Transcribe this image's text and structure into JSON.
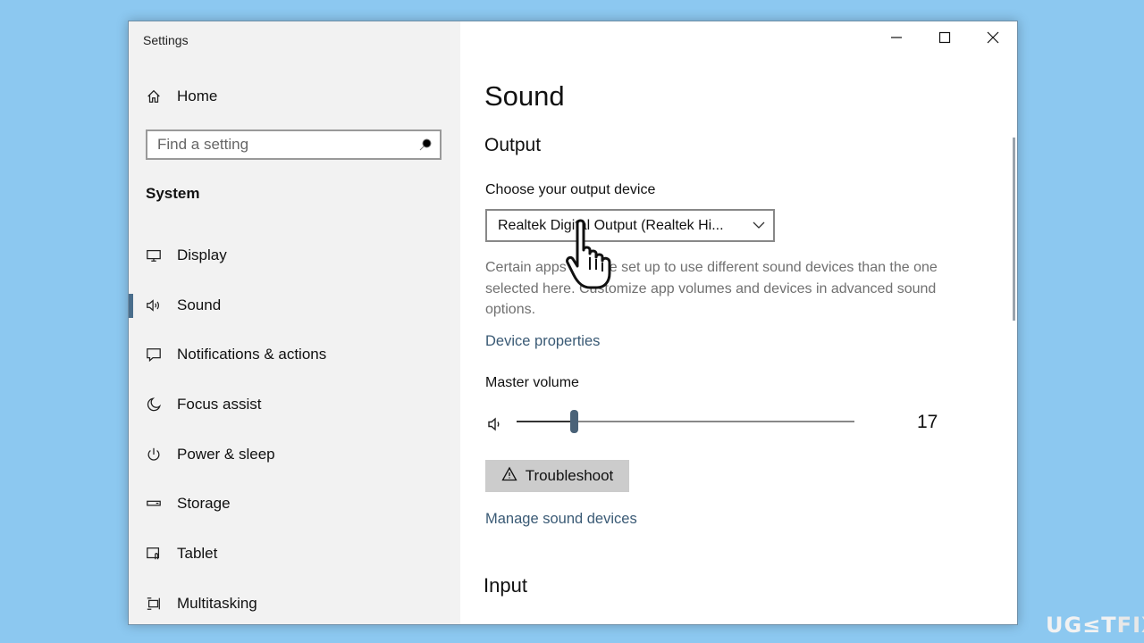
{
  "window": {
    "title": "Settings",
    "controls": [
      "minimize-icon",
      "maximize-icon",
      "close-icon"
    ]
  },
  "sidebar": {
    "home_label": "Home",
    "search_placeholder": "Find a setting",
    "section_label": "System",
    "items": [
      {
        "label": "Display",
        "icon": "display-icon",
        "active": false
      },
      {
        "label": "Sound",
        "icon": "speaker-icon",
        "active": true
      },
      {
        "label": "Notifications & actions",
        "icon": "notification-icon",
        "active": false
      },
      {
        "label": "Focus assist",
        "icon": "moon-icon",
        "active": false
      },
      {
        "label": "Power & sleep",
        "icon": "power-icon",
        "active": false
      },
      {
        "label": "Storage",
        "icon": "storage-icon",
        "active": false
      },
      {
        "label": "Tablet",
        "icon": "tablet-icon",
        "active": false
      },
      {
        "label": "Multitasking",
        "icon": "multitasking-icon",
        "active": false
      }
    ]
  },
  "main": {
    "title": "Sound",
    "output_heading": "Output",
    "choose_label": "Choose your output device",
    "output_device": "Realtek Digital Output (Realtek Hi...",
    "description": "Certain apps may be set up to use different sound devices than the one selected here. Customize app volumes and devices in advanced sound options.",
    "device_properties": "Device properties",
    "master_volume_label": "Master volume",
    "volume": {
      "value": 17,
      "max": 100,
      "display": "17"
    },
    "troubleshoot_label": "Troubleshoot",
    "manage_devices": "Manage sound devices",
    "input_heading": "Input"
  },
  "watermark": {
    "text_a": "UG",
    "text_b": "≤T",
    "text_c": "FIX"
  },
  "colors": {
    "background": "#8cc8f0",
    "sidebar": "#f2f2f2",
    "accent": "#4a6e8c",
    "link": "#3a5a75"
  }
}
